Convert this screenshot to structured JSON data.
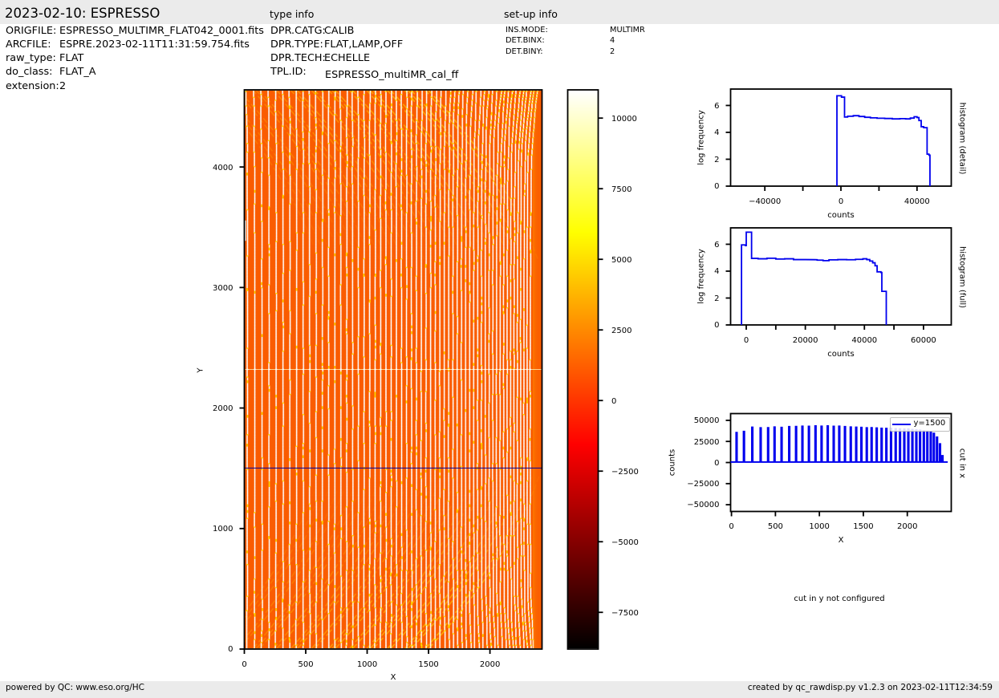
{
  "page": {
    "title": "2023-02-10: ESPRESSO",
    "type_info_heading": "type info",
    "setup_info_heading": "set-up info",
    "band_color": "#ebebeb",
    "accent_blue": "#0000ee"
  },
  "metadata": {
    "file_info": [
      {
        "label": "ORIGFILE:",
        "value": "ESPRESSO_MULTIMR_FLAT042_0001.fits"
      },
      {
        "label": "ARCFILE:",
        "value": "ESPRE.2023-02-11T11:31:59.754.fits"
      },
      {
        "label": "raw_type:",
        "value": "FLAT"
      },
      {
        "label": "do_class:",
        "value": "FLAT_A"
      },
      {
        "label": "extension:",
        "value": "2"
      }
    ],
    "type_info": [
      {
        "label": "DPR.CATG:",
        "value": "CALIB"
      },
      {
        "label": "DPR.TYPE:",
        "value": "FLAT,LAMP,OFF"
      },
      {
        "label": "DPR.TECH:",
        "value": "ECHELLE"
      },
      {
        "label": "TPL.ID:",
        "value": "ESPRESSO_multiMR_cal_ff"
      }
    ],
    "setup_info": [
      {
        "label": "INS.MODE:",
        "value": "MULTIMR"
      },
      {
        "label": "DET.BINX:",
        "value": "4"
      },
      {
        "label": "DET.BINY:",
        "value": "2"
      }
    ]
  },
  "footer": {
    "left": "powered by QC: www.eso.org/HC",
    "right": "created by qc_rawdisp.py v1.2.3 on 2023-02-11T12:34:59"
  },
  "chart_data": [
    {
      "id": "raw_image",
      "type": "heatmap",
      "xlabel": "X",
      "ylabel": "Y",
      "xlim": [
        0,
        2424
      ],
      "ylim": [
        0,
        4640
      ],
      "xticks": [
        0,
        500,
        1000,
        1500,
        2000
      ],
      "yticks": [
        0,
        1000,
        2000,
        3000,
        4000
      ],
      "colormap": "hot",
      "background_color": "#fa5c00",
      "stripe_color": "#ffffff",
      "speckle_color": "#ffe100",
      "gap_y": 2320,
      "cut_line": {
        "y": 1500,
        "color": "#00009b"
      },
      "stripe_first_x": 22,
      "stripe_last_x": 2352,
      "stripe_gap_start": 60,
      "stripe_gap_end": 25
    },
    {
      "id": "colorbar",
      "type": "colorbar",
      "colormap": "hot",
      "vmin": -8800,
      "vmax": 11000,
      "ticks": [
        10000,
        7500,
        5000,
        2500,
        0,
        -2500,
        -5000,
        -7500
      ],
      "tick_labels": [
        "10000",
        "7500",
        "5000",
        "2500",
        "0",
        "−2500",
        "−5000",
        "−7500"
      ]
    },
    {
      "id": "histogram_detail",
      "type": "line",
      "xlabel": "counts",
      "ylabel": "log frequency",
      "right_label": "histogram (detail)",
      "xlim": [
        -58000,
        58000
      ],
      "ylim": [
        0,
        7.22
      ],
      "xticks": [
        -40000,
        -20000,
        0,
        20000,
        40000
      ],
      "xtick_labels": [
        "−40000",
        "",
        "0",
        "",
        "40000"
      ],
      "yticks": [
        0,
        2,
        4,
        6
      ],
      "ytick_labels": [
        "0",
        "2",
        "4",
        "6"
      ],
      "line_color": "#0000ee",
      "points": [
        [
          -2100,
          0
        ],
        [
          -2100,
          6.72
        ],
        [
          300,
          6.72
        ],
        [
          300,
          6.62
        ],
        [
          1900,
          6.62
        ],
        [
          1900,
          5.14
        ],
        [
          3500,
          5.14
        ],
        [
          3500,
          5.2
        ],
        [
          6500,
          5.2
        ],
        [
          6500,
          5.24
        ],
        [
          9500,
          5.24
        ],
        [
          9500,
          5.18
        ],
        [
          12500,
          5.18
        ],
        [
          12500,
          5.12
        ],
        [
          15500,
          5.12
        ],
        [
          15500,
          5.08
        ],
        [
          19000,
          5.08
        ],
        [
          19000,
          5.05
        ],
        [
          23000,
          5.05
        ],
        [
          23000,
          5.03
        ],
        [
          27000,
          5.03
        ],
        [
          27000,
          5.0
        ],
        [
          31000,
          5.0
        ],
        [
          31000,
          5.02
        ],
        [
          34000,
          5.02
        ],
        [
          34000,
          5.0
        ],
        [
          36500,
          5.0
        ],
        [
          36500,
          5.06
        ],
        [
          38500,
          5.06
        ],
        [
          38500,
          5.16
        ],
        [
          40000,
          5.16
        ],
        [
          40000,
          5.1
        ],
        [
          41000,
          5.1
        ],
        [
          41000,
          4.88
        ],
        [
          42200,
          4.88
        ],
        [
          42200,
          4.42
        ],
        [
          43500,
          4.42
        ],
        [
          43500,
          4.35
        ],
        [
          45300,
          4.35
        ],
        [
          45300,
          2.38
        ],
        [
          46300,
          2.38
        ],
        [
          46300,
          2.3
        ],
        [
          46800,
          2.3
        ],
        [
          46800,
          0
        ]
      ]
    },
    {
      "id": "histogram_full",
      "type": "line",
      "xlabel": "counts",
      "ylabel": "log frequency",
      "right_label": "histogram (full)",
      "xlim": [
        -5300,
        69400
      ],
      "ylim": [
        0,
        7.22
      ],
      "xticks": [
        0,
        10000,
        20000,
        30000,
        40000,
        50000,
        60000
      ],
      "xtick_labels": [
        "0",
        "",
        "20000",
        "",
        "40000",
        "",
        "60000"
      ],
      "yticks": [
        0,
        2,
        4,
        6
      ],
      "ytick_labels": [
        "0",
        "2",
        "4",
        "6"
      ],
      "line_color": "#0000ee",
      "points": [
        [
          -1600,
          0
        ],
        [
          -1600,
          5.95
        ],
        [
          -300,
          5.95
        ],
        [
          -300,
          5.9
        ],
        [
          0,
          5.9
        ],
        [
          0,
          6.9
        ],
        [
          1800,
          6.9
        ],
        [
          1800,
          4.95
        ],
        [
          4000,
          4.95
        ],
        [
          4000,
          4.92
        ],
        [
          7000,
          4.92
        ],
        [
          7000,
          4.96
        ],
        [
          10000,
          4.96
        ],
        [
          10000,
          4.9
        ],
        [
          13000,
          4.9
        ],
        [
          13000,
          4.92
        ],
        [
          16000,
          4.92
        ],
        [
          16000,
          4.86
        ],
        [
          20000,
          4.86
        ],
        [
          24000,
          4.85
        ],
        [
          24000,
          4.82
        ],
        [
          26000,
          4.82
        ],
        [
          26000,
          4.78
        ],
        [
          28000,
          4.78
        ],
        [
          28000,
          4.84
        ],
        [
          31000,
          4.84
        ],
        [
          31000,
          4.86
        ],
        [
          34000,
          4.86
        ],
        [
          34000,
          4.85
        ],
        [
          37000,
          4.85
        ],
        [
          37000,
          4.88
        ],
        [
          39500,
          4.88
        ],
        [
          39500,
          4.92
        ],
        [
          40800,
          4.92
        ],
        [
          40800,
          4.86
        ],
        [
          41800,
          4.86
        ],
        [
          41800,
          4.75
        ],
        [
          42800,
          4.75
        ],
        [
          42800,
          4.62
        ],
        [
          43600,
          4.62
        ],
        [
          43600,
          4.4
        ],
        [
          44300,
          4.4
        ],
        [
          44300,
          3.95
        ],
        [
          45600,
          3.95
        ],
        [
          45600,
          3.9
        ],
        [
          45900,
          3.9
        ],
        [
          45900,
          2.5
        ],
        [
          47400,
          2.5
        ],
        [
          47400,
          0
        ]
      ]
    },
    {
      "id": "cut_in_x",
      "type": "line",
      "xlabel": "X",
      "ylabel": "counts",
      "right_label": "cut in x",
      "xlim": [
        -10,
        2500
      ],
      "ylim": [
        -58000,
        58000
      ],
      "xticks": [
        0,
        500,
        1000,
        1500,
        2000
      ],
      "xtick_labels": [
        "0",
        "500",
        "1000",
        "1500",
        "2000"
      ],
      "yticks": [
        50000,
        25000,
        0,
        -25000,
        -50000
      ],
      "ytick_labels": [
        "50000",
        "25000",
        "0",
        "−25000",
        "−50000"
      ],
      "line_color": "#0000ee",
      "legend": {
        "label": "y=1500"
      },
      "baseline_counts": 600,
      "spike_x": [
        58,
        142,
        237,
        332,
        417,
        490,
        570,
        657,
        735,
        807,
        881,
        956,
        1025,
        1095,
        1163,
        1226,
        1291,
        1357,
        1419,
        1478,
        1539,
        1594,
        1652,
        1708,
        1762,
        1815,
        1868,
        1917,
        1966,
        2012,
        2058,
        2103,
        2145,
        2188,
        2228,
        2267,
        2302,
        2338,
        2372,
        2400
      ],
      "spike_counts": [
        35500,
        36800,
        41800,
        41000,
        41200,
        42000,
        41500,
        42500,
        42600,
        43000,
        42800,
        43300,
        43000,
        43300,
        42800,
        43000,
        42500,
        42000,
        41800,
        41500,
        41000,
        41200,
        40800,
        40500,
        40300,
        40500,
        40000,
        39800,
        39500,
        39600,
        39000,
        38500,
        38200,
        37500,
        37000,
        36200,
        34500,
        30000,
        22000,
        8000
      ]
    },
    {
      "id": "cut_in_y",
      "type": "note",
      "text": "cut in y not configured"
    }
  ]
}
